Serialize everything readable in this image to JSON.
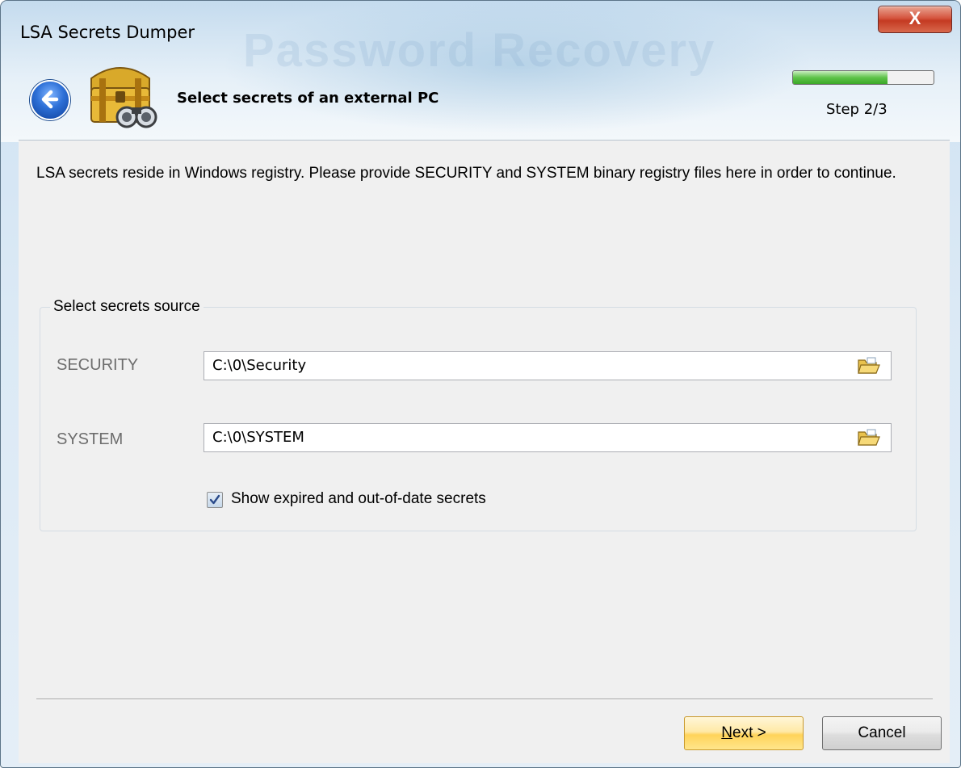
{
  "window": {
    "title": "LSA Secrets Dumper",
    "close_glyph": "X"
  },
  "header": {
    "subtitle": "Select secrets of an external PC",
    "step_label": "Step 2/3",
    "progress_fraction": 0.67,
    "back_icon": "back-arrow-icon",
    "app_icon": "treasure-chest-binoculars-icon"
  },
  "description": "LSA secrets reside in Windows registry. Please provide SECURITY and SYSTEM binary registry files here in order to continue.",
  "source_group": {
    "legend": "Select secrets source",
    "security_label": "SECURITY",
    "security_value": "C:\\0\\Security",
    "system_label": "SYSTEM",
    "system_value": "C:\\0\\SYSTEM",
    "browse_icon": "open-folder-icon",
    "show_expired_label": "Show expired and out-of-date secrets",
    "show_expired_checked": true
  },
  "buttons": {
    "next_mnemonic": "N",
    "next_rest": "ext >",
    "cancel": "Cancel"
  },
  "colors": {
    "progress_green": "#3aa827",
    "next_button": "#ffd35a",
    "close_button": "#c43a22"
  }
}
